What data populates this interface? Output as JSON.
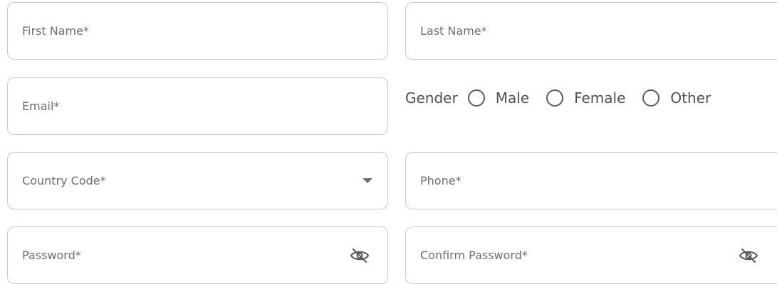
{
  "form": {
    "first_name": {
      "placeholder": "First Name*"
    },
    "last_name": {
      "placeholder": "Last Name*"
    },
    "email": {
      "placeholder": "Email*"
    },
    "gender": {
      "label": "Gender",
      "options": [
        "Male",
        "Female",
        "Other"
      ]
    },
    "country_code": {
      "placeholder": "Country Code*",
      "icon": "chevron-down-icon"
    },
    "phone": {
      "placeholder": "Phone*"
    },
    "password": {
      "placeholder": "Password*",
      "icon": "eye-off-icon"
    },
    "confirm_password": {
      "placeholder": "Confirm Password*",
      "icon": "eye-off-icon"
    }
  }
}
